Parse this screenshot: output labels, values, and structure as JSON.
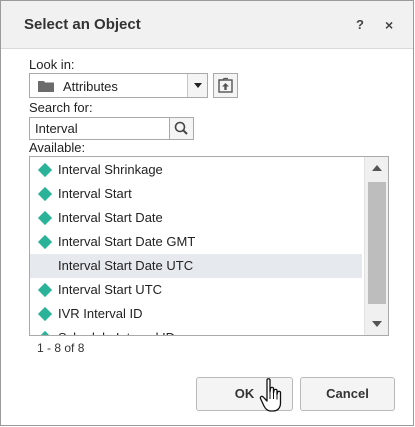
{
  "dialog": {
    "title": "Select an Object",
    "help_label": "?",
    "close_label": "×"
  },
  "look_in": {
    "label": "Look in:",
    "value": "Attributes",
    "icon": "folder-icon"
  },
  "search": {
    "label": "Search for:",
    "value": "Interval",
    "icon": "search-icon"
  },
  "available": {
    "label": "Available:",
    "items": [
      {
        "label": "Interval Shrinkage",
        "icon": "attribute-icon"
      },
      {
        "label": "Interval Start",
        "icon": "attribute-icon"
      },
      {
        "label": "Interval Start Date",
        "icon": "attribute-icon"
      },
      {
        "label": "Interval Start Date GMT",
        "icon": "attribute-icon"
      },
      {
        "label": "Interval Start Date UTC",
        "icon": "attribute-icon",
        "selected": true
      },
      {
        "label": "Interval Start UTC",
        "icon": "attribute-icon"
      },
      {
        "label": "IVR Interval ID",
        "icon": "attribute-icon"
      },
      {
        "label": "Schedule Interval ID",
        "icon": "attribute-icon"
      }
    ],
    "count_text": "1 - 8 of 8"
  },
  "buttons": {
    "ok_label": "OK",
    "cancel_label": "Cancel"
  },
  "colors": {
    "accent": "#2bb39a",
    "selection": "#e6e9ee",
    "titlebar": "#f1f1f1"
  }
}
